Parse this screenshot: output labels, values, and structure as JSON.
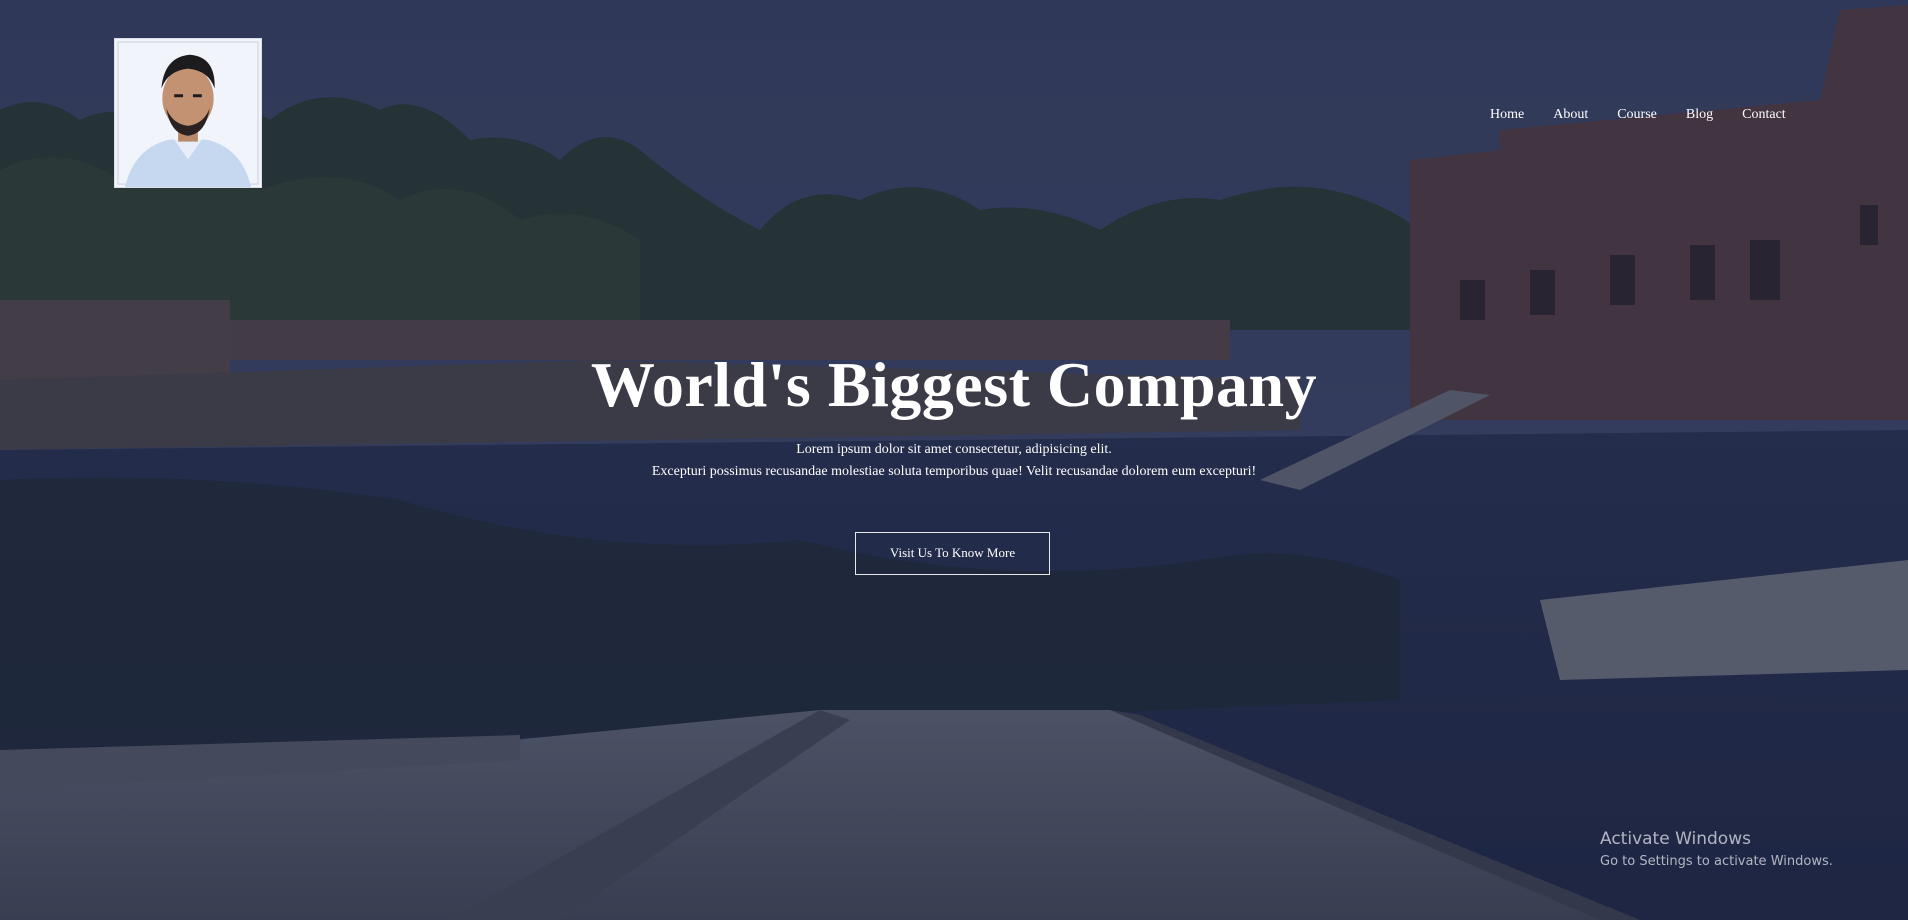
{
  "nav": {
    "items": [
      {
        "label": "Home"
      },
      {
        "label": "About"
      },
      {
        "label": "Course"
      },
      {
        "label": "Blog"
      },
      {
        "label": "Contact"
      }
    ]
  },
  "hero": {
    "title": "World's Biggest Company",
    "subtitle_line1": "Lorem ipsum dolor sit amet consectetur, adipisicing elit.",
    "subtitle_line2": "Excepturi possimus recusandae molestiae soluta temporibus quae! Velit recusandae dolorem eum excepturi!",
    "cta_label": "Visit Us To Know More"
  },
  "watermark": {
    "title": "Activate Windows",
    "subtitle": "Go to Settings to activate Windows."
  },
  "colors": {
    "overlay": "#1e2646",
    "text": "#ffffff"
  }
}
